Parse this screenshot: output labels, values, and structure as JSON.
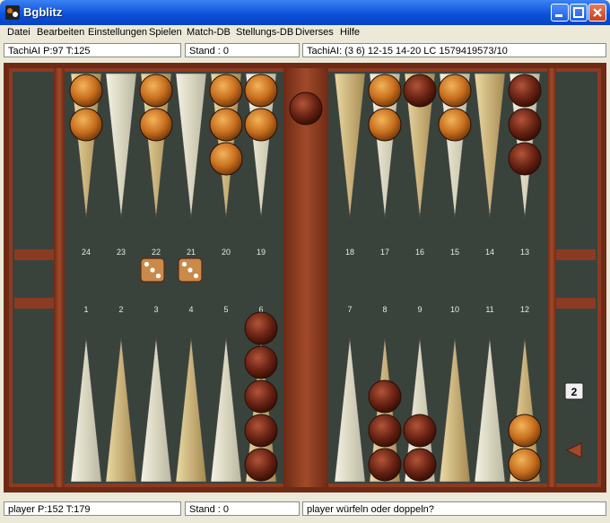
{
  "window": {
    "title": "Bgblitz"
  },
  "menu": [
    "Datei",
    "Bearbeiten",
    "Einstellungen",
    "Spielen",
    "Match-DB",
    "Stellungs-DB",
    "Diverses",
    "Hilfe"
  ],
  "top_status": {
    "opponent": "TachiAI  P:97 T:125",
    "score": "Stand : 0",
    "last_move": "TachiAI: (3 6) 12-15 14-20    LC 1579419573/10"
  },
  "bottom_status": {
    "player": "player  P:152 T:179",
    "score": "Stand : 0",
    "message": "player würfeln oder doppeln?"
  },
  "board": {
    "top_points": [
      "24",
      "23",
      "22",
      "21",
      "20",
      "19",
      "18",
      "17",
      "16",
      "15",
      "14",
      "13"
    ],
    "bottom_points": [
      "1",
      "2",
      "3",
      "4",
      "5",
      "6",
      "7",
      "8",
      "9",
      "10",
      "11",
      "12"
    ],
    "dice": [
      3,
      3
    ],
    "cube_value": "2",
    "checkers": {
      "top": {
        "24": {
          "color": "orange",
          "count": 2
        },
        "22": {
          "color": "orange",
          "count": 2
        },
        "20": {
          "color": "orange",
          "count": 3
        },
        "19": {
          "color": "orange",
          "count": 2
        },
        "17": {
          "color": "orange",
          "count": 2
        },
        "16": {
          "color": "dark",
          "count": 1
        },
        "15": {
          "color": "orange",
          "count": 2
        },
        "13": {
          "color": "dark",
          "count": 3
        }
      },
      "bottom": {
        "6": {
          "color": "dark",
          "count": 5
        },
        "8": {
          "color": "dark",
          "count": 3
        },
        "9": {
          "color": "dark",
          "count": 2
        },
        "12": {
          "color": "orange",
          "count": 2
        }
      },
      "bar": {
        "color": "dark",
        "count": 1
      }
    },
    "colors": {
      "felt": "#3a423c",
      "wood": "#8a3b22",
      "orange_checker": "#c9701f",
      "dark_checker": "#6b2414",
      "cream_point": "#d9d6bf",
      "tan_point": "#c9b27a"
    }
  }
}
